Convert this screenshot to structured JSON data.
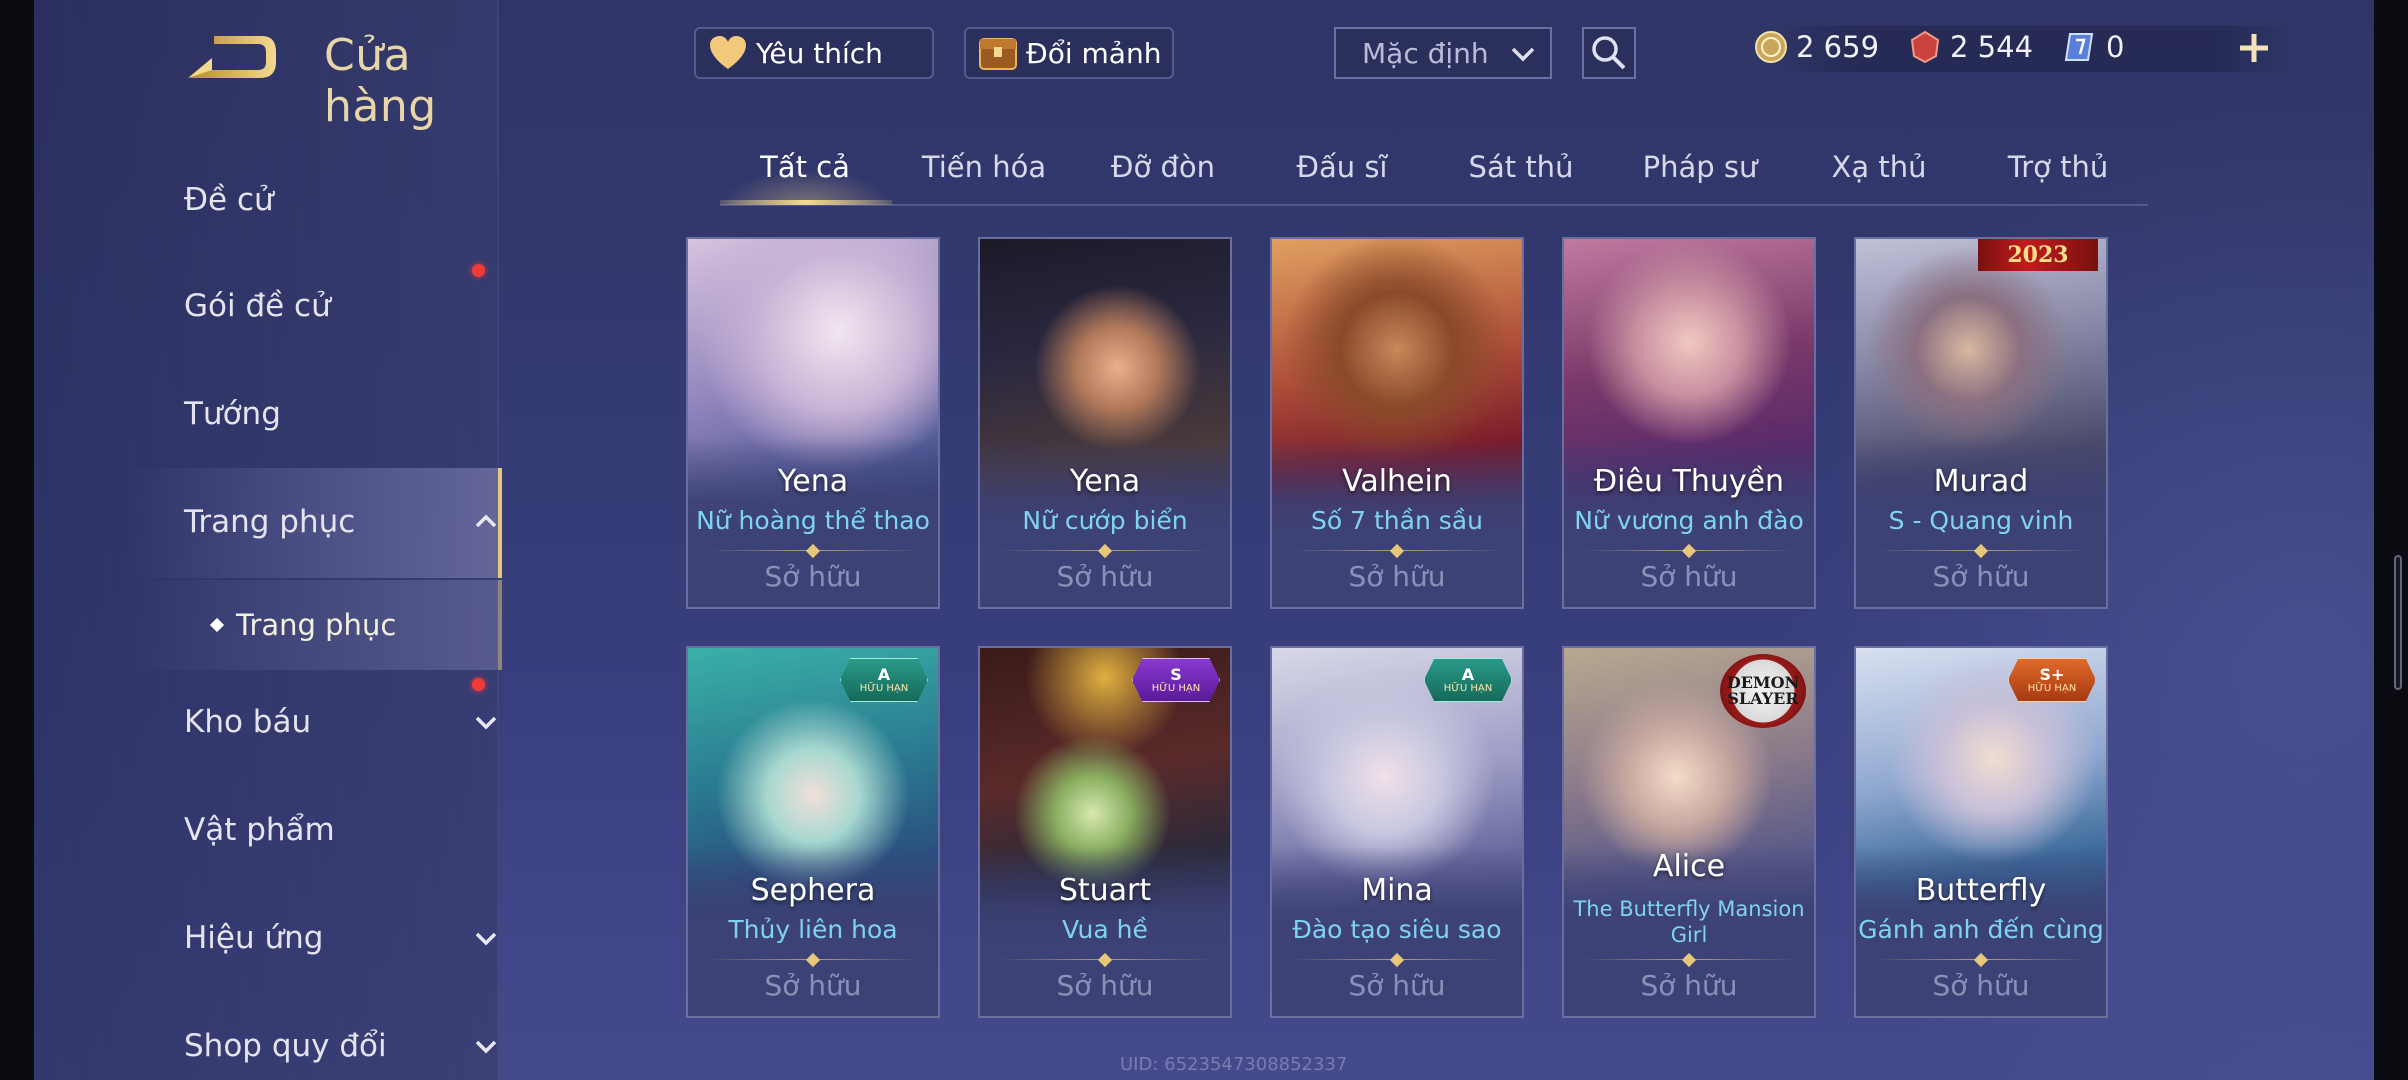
{
  "sidebar": {
    "title": "Cửa hàng",
    "items": [
      {
        "label": "Đề cử"
      },
      {
        "label": "Gói đề cử"
      },
      {
        "label": "Tướng"
      },
      {
        "label": "Trang phục"
      },
      {
        "label": "Kho báu"
      },
      {
        "label": "Vật phẩm"
      },
      {
        "label": "Hiệu ứng"
      },
      {
        "label": "Shop quy đổi"
      }
    ],
    "sub_item": "Trang phục"
  },
  "topbar": {
    "favorite_label": "Yêu thích",
    "exchange_label": "Đổi mảnh",
    "sort_value": "Mặc định",
    "currencies": {
      "gold": "2 659",
      "red": "2 544",
      "voucher": "0"
    }
  },
  "tabs": [
    "Tất cả",
    "Tiến hóa",
    "Đỡ đòn",
    "Đấu sĩ",
    "Sát thủ",
    "Pháp sư",
    "Xạ thủ",
    "Trợ thủ"
  ],
  "cards": [
    {
      "hero": "Yena",
      "skin": "Nữ hoàng thể thao",
      "status": "Sở hữu"
    },
    {
      "hero": "Yena",
      "skin": "Nữ cướp biển",
      "status": "Sở hữu"
    },
    {
      "hero": "Valhein",
      "skin": "Số 7 thần sầu",
      "status": "Sở hữu"
    },
    {
      "hero": "Điêu Thuyền",
      "skin": "Nữ vương anh đào",
      "status": "Sở hữu"
    },
    {
      "hero": "Murad",
      "skin": "S - Quang vinh",
      "status": "Sở hữu",
      "year_badge": "2023"
    },
    {
      "hero": "Sephera",
      "skin": "Thủy liên hoa",
      "status": "Sở hữu",
      "tier": "A",
      "limited": "HỮU HẠN"
    },
    {
      "hero": "Stuart",
      "skin": "Vua hề",
      "status": "Sở hữu",
      "tier": "S",
      "limited": "HỮU HẠN"
    },
    {
      "hero": "Mina",
      "skin": "Đào tạo siêu sao",
      "status": "Sở hữu",
      "tier": "A",
      "limited": "HỮU HẠN"
    },
    {
      "hero": "Alice",
      "skin_line1": "The Butterfly Mansion",
      "skin_line2": "Girl",
      "status": "Sở hữu",
      "logo": "DEMON SLAYER"
    },
    {
      "hero": "Butterfly",
      "skin": "Gánh anh đến cùng",
      "status": "Sở hữu",
      "tier": "S+",
      "limited": "HỮU HẠN"
    }
  ],
  "uid": "UID: 6523547308852337",
  "colors": {
    "accent_gold": "#e7c77a",
    "skin_name": "#7fd3f2",
    "badge_red": "#f03a3a"
  }
}
